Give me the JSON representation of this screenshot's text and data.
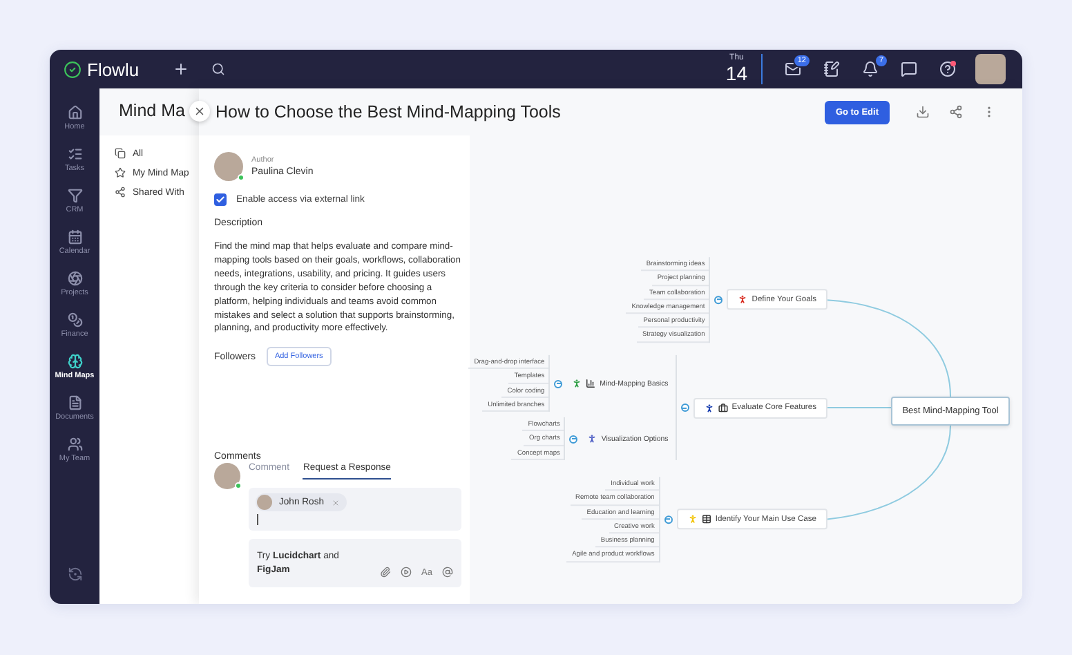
{
  "topbar": {
    "logo": "Flowlu",
    "date": {
      "weekday": "Thu",
      "day": "14"
    },
    "notifications": [
      {
        "kind": "mail",
        "badge": "12"
      },
      {
        "kind": "notes"
      },
      {
        "kind": "bell",
        "badge": "7"
      },
      {
        "kind": "chat"
      },
      {
        "kind": "help",
        "dot": true
      }
    ]
  },
  "nav": {
    "items": [
      {
        "label": "Home",
        "selected": false
      },
      {
        "label": "Tasks",
        "selected": false
      },
      {
        "label": "CRM",
        "selected": false
      },
      {
        "label": "Calendar",
        "selected": false
      },
      {
        "label": "Projects",
        "selected": false
      },
      {
        "label": "Finance",
        "selected": false
      },
      {
        "label": "Mind Maps",
        "selected": true
      },
      {
        "label": "Documents",
        "selected": false
      },
      {
        "label": "My Team",
        "selected": false
      }
    ]
  },
  "section": {
    "title": "Mind Ma",
    "items": [
      {
        "kind": "all",
        "label": "All"
      },
      {
        "kind": "mine",
        "label": "My Mind Map"
      },
      {
        "kind": "shared",
        "label": "Shared With"
      }
    ]
  },
  "panel": {
    "title": "How to Choose the Best Mind-Mapping Tools",
    "edit_button": "Go to Edit",
    "author": {
      "label": "Author",
      "name": "Paulina Clevin",
      "online": true
    },
    "external_link": {
      "label": "Enable access via external link",
      "checked": true
    },
    "description": {
      "heading": "Description",
      "text": "Find the mind map that helps evaluate and compare mind-mapping tools based on their goals, workflows, collaboration needs, integrations, usability, and pricing. It guides users through the key criteria to consider before choosing a platform, helping individuals and teams avoid common mistakes and select a solution that supports brainstorming, planning, and productivity more effectively."
    },
    "followers": {
      "label": "Followers",
      "button": "Add Followers"
    },
    "comments": {
      "heading": "Comments",
      "tabs": [
        {
          "label": "Comment",
          "selected": false
        },
        {
          "label": "Request a Response",
          "selected": true
        }
      ],
      "mention": "John Rosh",
      "composer": "Try **Lucidchart** and **FigJam**",
      "format_button": "Aa"
    }
  },
  "mind_map": {
    "root": "Best Mind-Mapping Tool",
    "branches": [
      {
        "label": "Define Your Goals",
        "color": "#d93025",
        "children": [
          {
            "label": "Brainstorming ideas"
          },
          {
            "label": "Project planning"
          },
          {
            "label": "Team collaboration"
          },
          {
            "label": "Knowledge management"
          },
          {
            "label": "Personal productivity"
          },
          {
            "label": "Strategy visualization"
          }
        ]
      },
      {
        "label": "Evaluate Core Features",
        "color": "#1a3fb0",
        "children": [
          {
            "label": "Mind-Mapping Basics",
            "color": "#2e9e44",
            "children": [
              {
                "label": "Drag-and-drop interface"
              },
              {
                "label": "Templates"
              },
              {
                "label": "Color coding"
              },
              {
                "label": "Unlimited branches"
              }
            ]
          },
          {
            "label": "Visualization Options",
            "color": "#4a5bc4",
            "children": [
              {
                "label": "Flowcharts"
              },
              {
                "label": "Org charts"
              },
              {
                "label": "Concept maps"
              }
            ]
          }
        ]
      },
      {
        "label": "Identify Your Main Use Case",
        "color": "#f2c200",
        "children": [
          {
            "label": "Individual work"
          },
          {
            "label": "Remote team collaboration"
          },
          {
            "label": "Education and learning"
          },
          {
            "label": "Creative work"
          },
          {
            "label": "Business planning"
          },
          {
            "label": "Agile and product workflows"
          }
        ]
      }
    ]
  }
}
